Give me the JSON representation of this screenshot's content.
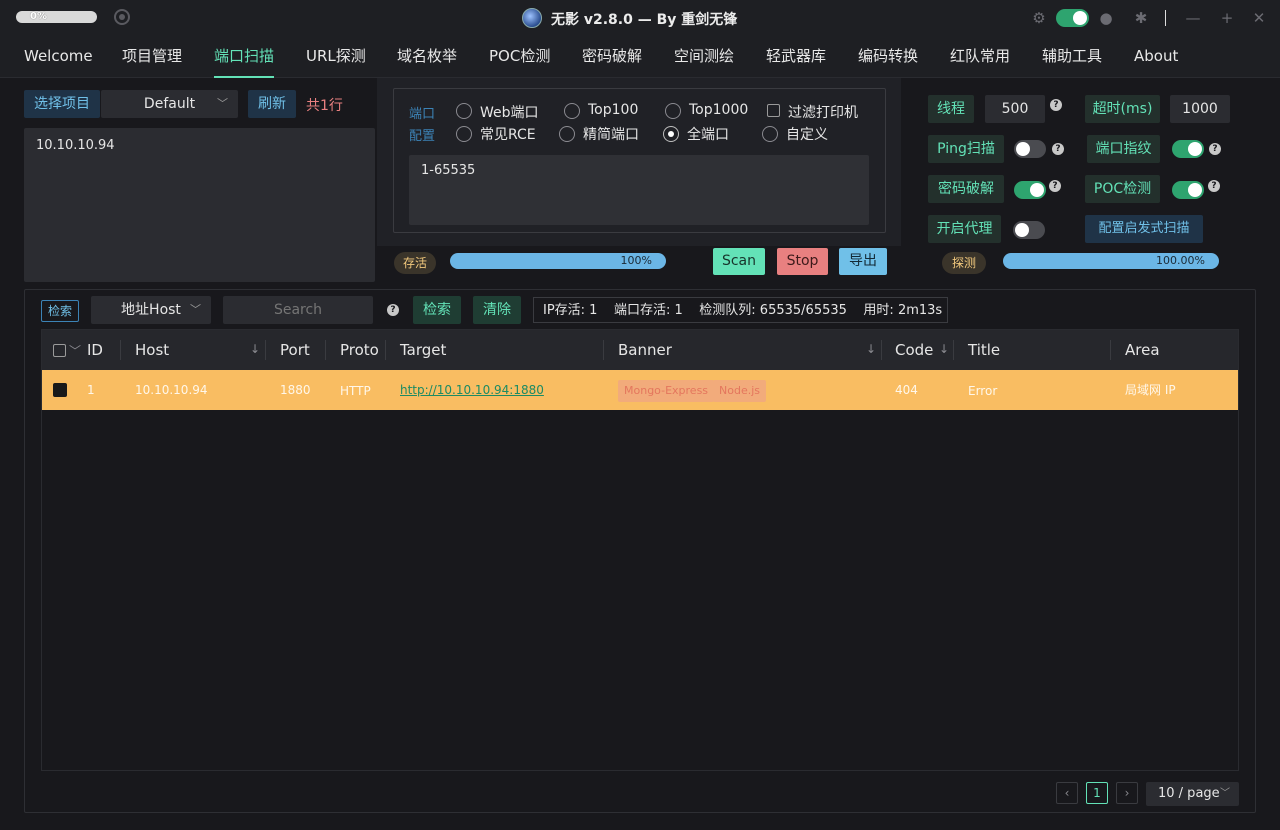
{
  "titlebar": {
    "progress": "0%",
    "title": "无影 v2.8.0 — By 重剑无锋",
    "theme_on": true
  },
  "menu": [
    "Welcome",
    "项目管理",
    "端口扫描",
    "URL探测",
    "域名枚举",
    "POC检测",
    "密码破解",
    "空间测绘",
    "轻武器库",
    "编码转换",
    "红队常用",
    "辅助工具",
    "About"
  ],
  "menu_active": "端口扫描",
  "target": {
    "select_label": "选择项目",
    "project": "Default",
    "refresh": "刷新",
    "line_count": "共1行",
    "textarea": "10.10.10.94"
  },
  "ports": {
    "label_line1": "端口",
    "label_line2": "配置",
    "options": [
      "Web端口",
      "Top100",
      "Top1000",
      "常见RCE",
      "精简端口",
      "全端口",
      "自定义"
    ],
    "selected": "全端口",
    "filter_printer": "过滤打印机",
    "range": "1-65535"
  },
  "alive": {
    "tag": "存活",
    "progress": "100%",
    "progress_value": 100
  },
  "actions": {
    "scan": "Scan",
    "stop": "Stop",
    "export": "导出"
  },
  "settings": {
    "threads_label": "线程",
    "threads": "500",
    "timeout_label": "超时(ms)",
    "timeout": "1000",
    "ping_label": "Ping扫描",
    "ping_on": false,
    "fingerprint_label": "端口指纹",
    "fingerprint_on": true,
    "brute_label": "密码破解",
    "brute_on": true,
    "poc_label": "POC检测",
    "poc_on": true,
    "proxy_label": "开启代理",
    "proxy_on": false,
    "heuristic_label": "配置启发式扫描",
    "detect_tag": "探测",
    "detect_progress": "100.00%",
    "detect_value": 100
  },
  "search": {
    "tag": "检索",
    "field": "地址Host",
    "placeholder": "Search",
    "search_btn": "检索",
    "clear_btn": "清除",
    "stats": "IP存活: 1    端口存活: 1    检测队列: 65535/65535    用时: 2m13s"
  },
  "table": {
    "columns": [
      "ID",
      "Host",
      "Port",
      "Proto",
      "Target",
      "Banner",
      "Code",
      "Title",
      "Area"
    ],
    "rows": [
      {
        "id": "1",
        "host": "10.10.10.94",
        "port": "1880",
        "proto": "HTTP",
        "target": "http://10.10.10.94:1880",
        "banner": [
          "Mongo-Express",
          "Node.js"
        ],
        "code": "404",
        "title": "Error",
        "area": "局域网 IP"
      }
    ]
  },
  "pagination": {
    "current": "1",
    "page_size": "10 / page"
  },
  "colors": {
    "accent": "#63e2b7",
    "row_highlight": "#f9bd62",
    "stop": "#e88080",
    "info": "#70c0e8"
  }
}
